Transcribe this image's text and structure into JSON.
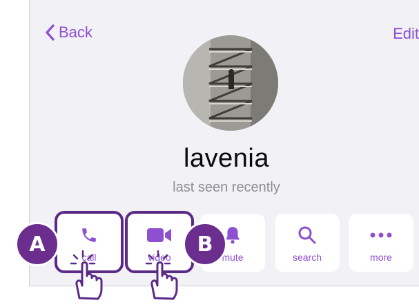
{
  "nav": {
    "back_label": "Back",
    "edit_label": "Edit"
  },
  "profile": {
    "name": "lavenia",
    "status": "last seen recently"
  },
  "actions": [
    {
      "label": "call",
      "icon": "phone-icon"
    },
    {
      "label": "video",
      "icon": "video-camera-icon"
    },
    {
      "label": "mute",
      "icon": "bell-icon"
    },
    {
      "label": "search",
      "icon": "magnifier-icon"
    },
    {
      "label": "more",
      "icon": "ellipsis-icon"
    }
  ],
  "callouts": {
    "a": "A",
    "b": "B"
  },
  "colors": {
    "accent": "#8e4fd1",
    "background": "#f1f1f6",
    "badge": "#6b2e8f",
    "highlight_border": "#5b2a86"
  }
}
